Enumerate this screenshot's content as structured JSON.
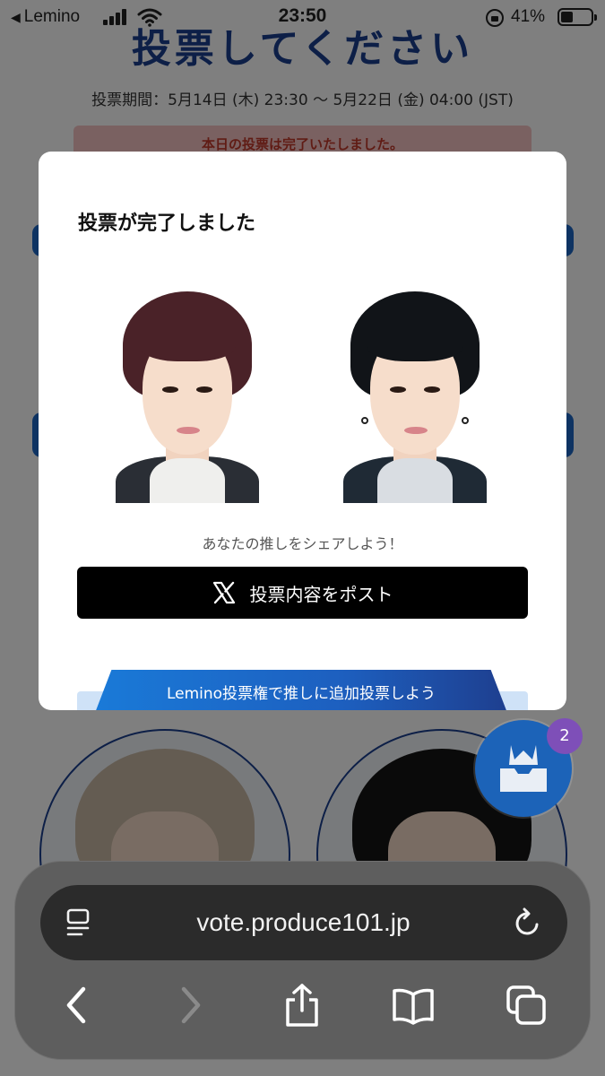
{
  "status_bar": {
    "back_app": "Lemino",
    "time": "23:50",
    "battery": "41%"
  },
  "page": {
    "title": "投票してください",
    "vote_period": "投票期間：5月14日 (木) 23:30 〜 5月22日 (金) 04:00 (JST)",
    "voted_notice": "本日の投票は完了いたしました。"
  },
  "modal": {
    "title": "投票が完了しました",
    "share_caption": "あなたの推しをシェアしよう！",
    "post_button": "投票内容をポスト",
    "extra_vote_banner": "Lemino投票権で推しに追加投票しよう"
  },
  "vote_fab": {
    "badge": "2"
  },
  "browser": {
    "url": "vote.produce101.jp"
  },
  "colors": {
    "brand_navy": "#1a3f8f",
    "button_black": "#000000",
    "banner_blue": "#1a7ad8",
    "badge_purple": "#7e4fb8"
  },
  "icons": [
    "back-triangle-icon",
    "signal-icon",
    "wifi-icon",
    "orientation-lock-icon",
    "battery-icon",
    "x-logo-icon",
    "ballot-box-icon",
    "reader-mode-icon",
    "reload-icon",
    "back-arrow-icon",
    "forward-arrow-icon",
    "share-icon",
    "bookmarks-icon",
    "tabs-icon"
  ]
}
